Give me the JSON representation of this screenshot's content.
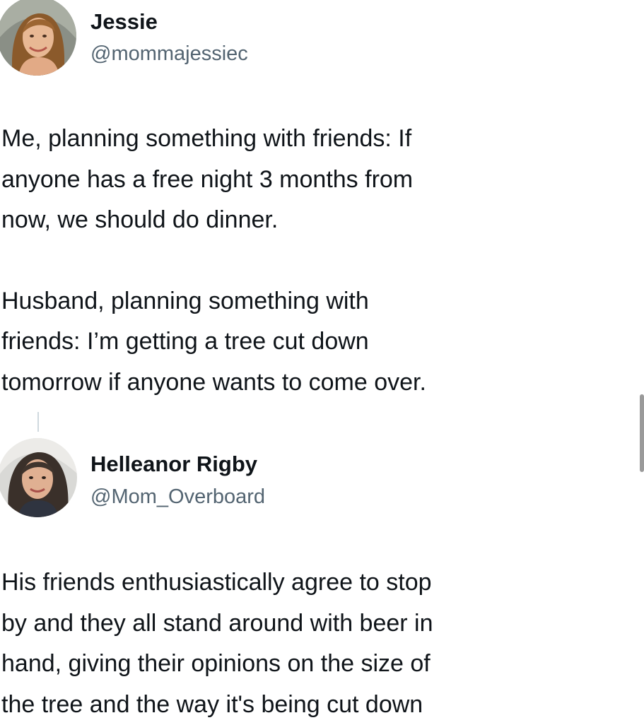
{
  "tweets": [
    {
      "author": {
        "display_name": "Jessie",
        "handle": "@mommajessiec",
        "avatar_icon": "woman-avatar-photo"
      },
      "paragraphs": [
        "Me, planning something with friends: If\nanyone has a free night 3 months from\nnow, we should do dinner.",
        "Husband, planning  something with\nfriends: I’m getting a tree cut down\ntomorrow if anyone wants to come over."
      ]
    },
    {
      "author": {
        "display_name": "Helleanor Rigby",
        "handle": "@Mom_Overboard",
        "avatar_icon": "woman-avatar-photo"
      },
      "paragraphs": [
        "His friends enthusiastically agree to stop\nby and they all stand around with beer in\nhand, giving their opinions on the size of\nthe tree and the way it's being cut down"
      ]
    }
  ],
  "colors": {
    "text": "#0f1419",
    "handle": "#536471",
    "thread_line": "#cfd9de"
  }
}
